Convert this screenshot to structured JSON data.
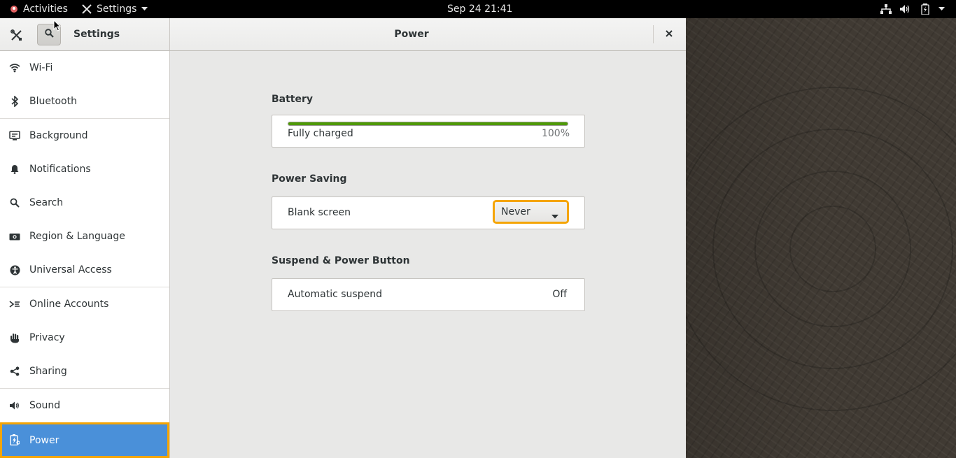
{
  "topbar": {
    "activities": "Activities",
    "app_menu": "Settings",
    "clock": "Sep 24  21:41"
  },
  "window": {
    "sidebar_title": "Settings",
    "panel_title": "Power"
  },
  "sidebar": {
    "items": [
      {
        "label": "Wi-Fi",
        "icon": "wifi-icon"
      },
      {
        "label": "Bluetooth",
        "icon": "bluetooth-icon"
      },
      {
        "label": "Background",
        "icon": "background-icon"
      },
      {
        "label": "Notifications",
        "icon": "bell-icon"
      },
      {
        "label": "Search",
        "icon": "search-icon"
      },
      {
        "label": "Region & Language",
        "icon": "camera-icon"
      },
      {
        "label": "Universal Access",
        "icon": "accessibility-icon"
      },
      {
        "label": "Online Accounts",
        "icon": "online-accounts-icon"
      },
      {
        "label": "Privacy",
        "icon": "hand-icon"
      },
      {
        "label": "Sharing",
        "icon": "share-icon"
      },
      {
        "label": "Sound",
        "icon": "speaker-icon"
      },
      {
        "label": "Power",
        "icon": "power-icon",
        "selected": true
      }
    ]
  },
  "power": {
    "battery": {
      "title": "Battery",
      "status": "Fully charged",
      "percent": "100%",
      "level": 1.0
    },
    "saving": {
      "title": "Power Saving",
      "blank_screen_label": "Blank screen",
      "blank_screen_value": "Never"
    },
    "suspend": {
      "title": "Suspend & Power Button",
      "auto_suspend_label": "Automatic suspend",
      "auto_suspend_value": "Off"
    }
  },
  "colors": {
    "selected_bg": "#4a90d9",
    "focus_ring": "#f5a505",
    "battery_fill": "#4e9a06"
  }
}
